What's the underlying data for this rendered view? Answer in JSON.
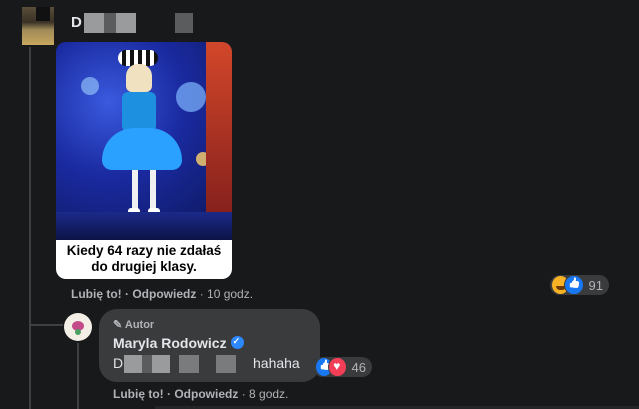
{
  "top_comment": {
    "author_initial": "D",
    "image_caption_line1": "Kiedy 64 razy nie zdałaś",
    "image_caption_line2": "do drugiej klasy.",
    "like_label": "Lubię to!",
    "reply_label": "Odpowiedz",
    "time": "10 godz.",
    "reaction_count": "91",
    "reactions": [
      "haha",
      "like"
    ]
  },
  "reply": {
    "badge_label": "Autor",
    "author_name": "Maryla Rodowicz",
    "verified": true,
    "text_initial": "D",
    "text_visible": "hahaha",
    "like_label": "Lubię to!",
    "reply_label": "Odpowiedz",
    "time": "8 godz.",
    "reaction_count": "46",
    "reactions": [
      "like",
      "love"
    ]
  },
  "colors": {
    "background": "#18191a",
    "bubble": "#3a3b3c",
    "text_primary": "#e4e6eb",
    "text_secondary": "#b0b3b8",
    "verified": "#2d88ff"
  }
}
